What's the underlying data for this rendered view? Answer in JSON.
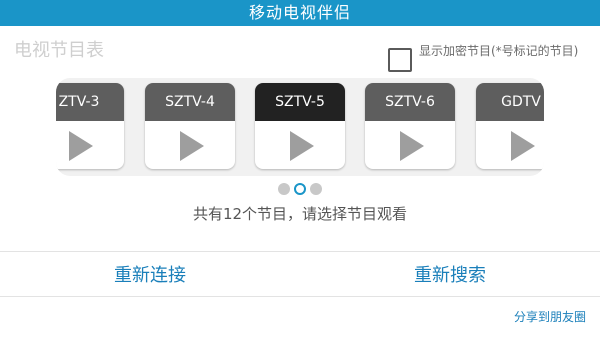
{
  "app": {
    "title": "移动电视伴侣"
  },
  "program_guide": {
    "title": "电视节目表"
  },
  "encrypted": {
    "label": "显示加密节目(*号标记的节目)",
    "checked": false
  },
  "channels": [
    {
      "name": "ZTV-3",
      "selected": false
    },
    {
      "name": "SZTV-4",
      "selected": false
    },
    {
      "name": "SZTV-5",
      "selected": true
    },
    {
      "name": "SZTV-6",
      "selected": false
    },
    {
      "name": "GDTV",
      "selected": false
    }
  ],
  "pager": {
    "pages": 3,
    "current": 2
  },
  "status": {
    "text": "共有12个节目，请选择节目观看"
  },
  "actions": {
    "reconnect": "重新连接",
    "rescan": "重新搜索"
  },
  "share": {
    "label": "分享到朋友圈"
  },
  "colors": {
    "titlebar": "#1a95c8",
    "accent": "#1a7fba",
    "card_head": "#5e5e5e",
    "card_selected": "#222222"
  },
  "icons": {
    "play": "play-icon"
  }
}
